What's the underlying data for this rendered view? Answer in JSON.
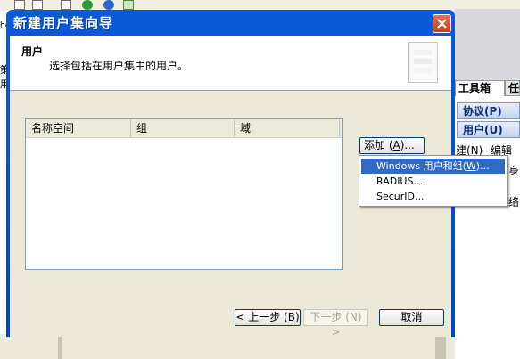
{
  "background": {
    "left_fragments": [
      "he",
      "策",
      "用"
    ],
    "right_tabs": [
      "工具箱",
      "任"
    ],
    "right_buttons": [
      "协议(P)",
      "用户(U)"
    ],
    "right_fragments": [
      "建(N)",
      "编辑(E",
      "身",
      "络"
    ]
  },
  "wizard": {
    "title": "新建用户集向导",
    "header_title": "用户",
    "header_subtitle": "选择包括在用户集中的用户。",
    "columns": [
      "名称空间",
      "组",
      "域"
    ],
    "add_button": {
      "prefix": "添加 (",
      "key": "A",
      "suffix": ")..."
    },
    "back_button": {
      "prefix": "< 上一步 (",
      "key": "B",
      "suffix": ")"
    },
    "next_button": {
      "prefix": "下一步 (",
      "key": "N",
      "suffix": ") >"
    },
    "cancel_button": "取消"
  },
  "add_menu": {
    "items": [
      {
        "prefix": "Windows 用户和组(",
        "key": "W",
        "suffix": ")..."
      },
      {
        "label": "RADIUS..."
      },
      {
        "label": "SecurID..."
      }
    ],
    "selected_index": 0
  },
  "colors": {
    "title_bar": "#0a5ad8",
    "close_button": "#d8542f",
    "menu_highlight": "#316ac5"
  }
}
